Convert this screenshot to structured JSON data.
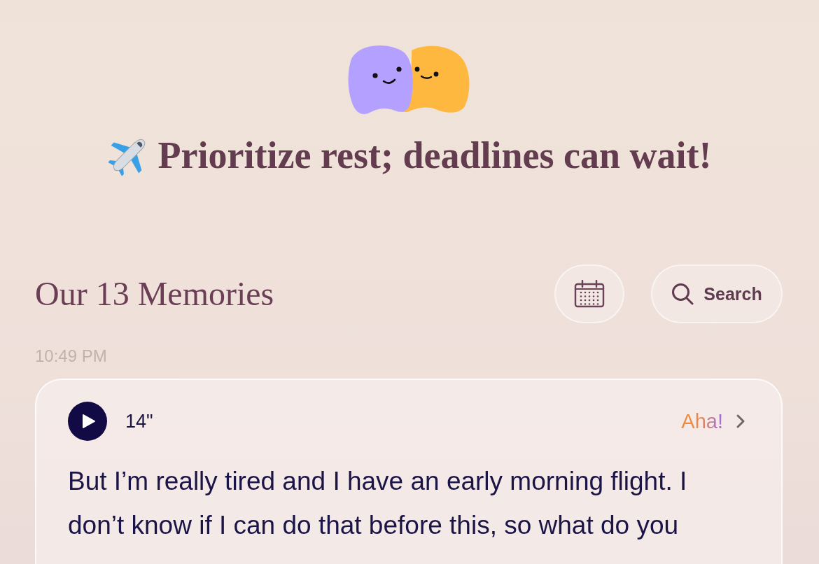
{
  "header": {
    "title": "Prioritize rest; deadlines can wait!"
  },
  "memories": {
    "heading": "Our 13 Memories",
    "search": {
      "label": "Search"
    }
  },
  "entries": [
    {
      "time": "10:49 PM",
      "duration": "14\"",
      "tag": "Aha!",
      "text": "But I’m really tired and I have an early morning flight. I don’t know if I can do that before this, so what do you"
    }
  ]
}
